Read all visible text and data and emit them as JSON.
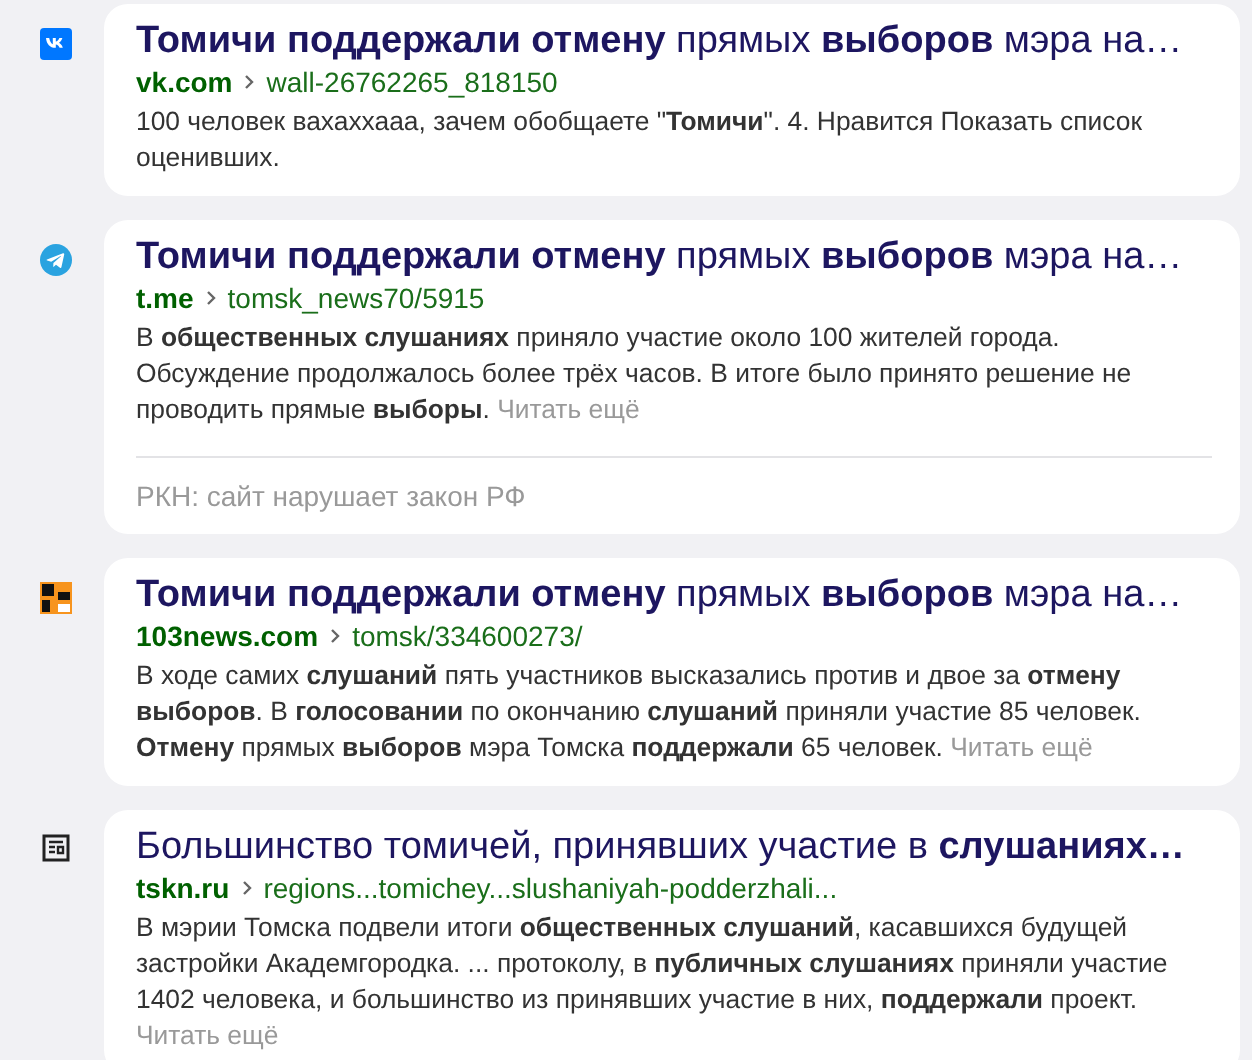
{
  "results": [
    {
      "kind": "vk",
      "title": "**Томичи поддержали отмену** прямых **выборов** мэра на…",
      "domain": "vk.com",
      "path": "wall-26762265_818150",
      "snippet": "100 человек вахаххааа, зачем обобщаете \"**Томичи**\". 4. Нравится Показать список оценивших."
    },
    {
      "kind": "telegram",
      "title": "**Томичи поддержали отмену** прямых **выборов** мэра на…",
      "domain": "t.me",
      "path": "tomsk_news70/5915",
      "snippet": "В **общественных слушаниях** приняло участие около 100 жителей города. Обсуждение продолжалось более трёх часов. В итоге было принято решение не проводить прямые **выборы**.",
      "read_more": "Читать ещё",
      "warning": "РКН: сайт нарушает закон РФ"
    },
    {
      "kind": "news",
      "title": "**Томичи поддержали отмену** прямых **выборов** мэра на…",
      "domain": "103news.com",
      "path": "tomsk/334600273/",
      "snippet": "В ходе самих **слушаний** пять участников высказались против и двое за **отмену выборов**. В **голосовании** по окончанию **слушаний** приняли участие 85 человек. **Отмену** прямых **выборов** мэра Томска **поддержали** 65 человек.",
      "read_more": "Читать ещё"
    },
    {
      "kind": "doc",
      "title": "Большинство томичей, принявших участие в **слушаниях…**",
      "domain": "tskn.ru",
      "path": "regions...tomichey...slushaniyah-podderzhali...",
      "snippet": "В мэрии Томска подвели итоги **общественных слушаний**, касавшихся будущей застройки Академгородка. ... протоколу, в **публичных слушаниях** приняли участие 1402 человека, и большинство из принявших участие в них, **поддержали** проект.",
      "read_more": "Читать ещё"
    }
  ]
}
